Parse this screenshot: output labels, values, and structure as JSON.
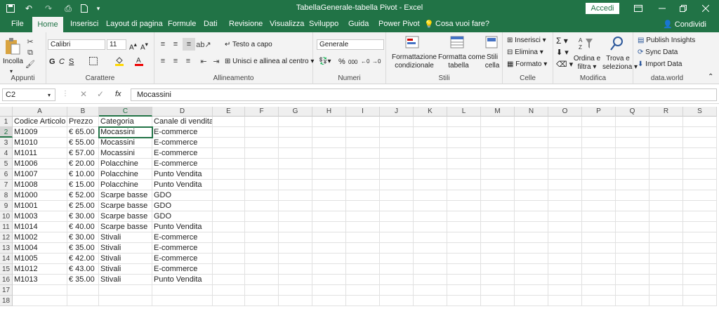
{
  "title": "TabellaGenerale-tabella Pivot  -  Excel",
  "signin": "Accedi",
  "share": "Condividi",
  "tabs": [
    "File",
    "Home",
    "Inserisci",
    "Layout di pagina",
    "Formule",
    "Dati",
    "Revisione",
    "Visualizza",
    "Sviluppo",
    "Guida",
    "Power Pivot",
    "Cosa vuoi fare?"
  ],
  "ribbon": {
    "clipboard": {
      "paste": "Incolla",
      "label": "Appunti"
    },
    "font": {
      "name": "Calibri",
      "size": "11",
      "label": "Carattere"
    },
    "align": {
      "wrap": "Testo a capo",
      "merge": "Unisci e allinea al centro",
      "label": "Allineamento"
    },
    "number": {
      "format": "Generale",
      "label": "Numeri"
    },
    "styles": {
      "cond1": "Formattazione",
      "cond2": "condizionale",
      "table1": "Formatta come",
      "table2": "tabella",
      "cell1": "Stili",
      "cell2": "cella",
      "label": "Stili"
    },
    "cells": {
      "insert": "Inserisci",
      "delete": "Elimina",
      "format": "Formato",
      "label": "Celle"
    },
    "editing": {
      "sort1": "Ordina e",
      "sort2": "filtra",
      "find1": "Trova e",
      "find2": "seleziona",
      "label": "Modifica"
    },
    "dataworld": {
      "publish": "Publish Insights",
      "sync": "Sync Data",
      "import": "Import Data",
      "label": "data.world"
    }
  },
  "formula": {
    "namebox": "C2",
    "value": "Mocassini"
  },
  "columns": [
    "A",
    "B",
    "C",
    "D",
    "E",
    "F",
    "G",
    "H",
    "I",
    "J",
    "K",
    "L",
    "M",
    "N",
    "O",
    "P",
    "Q",
    "R",
    "S"
  ],
  "rows": [
    [
      "Codice Articolo",
      "Prezzo",
      "Categoria",
      "Canale di vendita"
    ],
    [
      "M1009",
      "€  65.00",
      "Mocassini",
      "E-commerce"
    ],
    [
      "M1010",
      "€  55.00",
      "Mocassini",
      "E-commerce"
    ],
    [
      "M1011",
      "€  57.00",
      "Mocassini",
      "E-commerce"
    ],
    [
      "M1006",
      "€  20.00",
      "Polacchine",
      "E-commerce"
    ],
    [
      "M1007",
      "€  10.00",
      "Polacchine",
      "Punto Vendita"
    ],
    [
      "M1008",
      "€  15.00",
      "Polacchine",
      "Punto Vendita"
    ],
    [
      "M1000",
      "€  52.00",
      "Scarpe basse",
      "GDO"
    ],
    [
      "M1001",
      "€  25.00",
      "Scarpe basse",
      "GDO"
    ],
    [
      "M1003",
      "€  30.00",
      "Scarpe basse",
      "GDO"
    ],
    [
      "M1014",
      "€  40.00",
      "Scarpe basse",
      "Punto Vendita"
    ],
    [
      "M1002",
      "€  30.00",
      "Stivali",
      "E-commerce"
    ],
    [
      "M1004",
      "€  35.00",
      "Stivali",
      "E-commerce"
    ],
    [
      "M1005",
      "€  42.00",
      "Stivali",
      "E-commerce"
    ],
    [
      "M1012",
      "€  43.00",
      "Stivali",
      "E-commerce"
    ],
    [
      "M1013",
      "€  35.00",
      "Stivali",
      "Punto Vendita"
    ],
    [
      "",
      "",
      "",
      ""
    ],
    [
      "",
      "",
      "",
      ""
    ]
  ]
}
